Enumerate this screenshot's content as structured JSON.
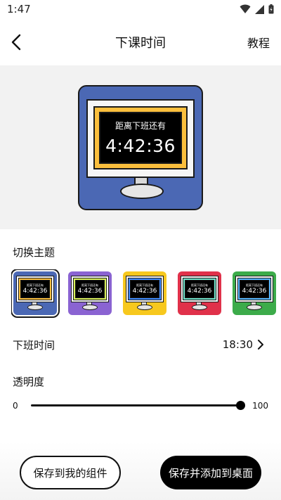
{
  "status_bar": {
    "time": "1:47",
    "icons": [
      "wifi-icon",
      "signal-icon",
      "battery-icon"
    ]
  },
  "header": {
    "title": "下课时间",
    "tutorial": "教程",
    "back_icon": "chevron-left-icon"
  },
  "preview": {
    "label": "距离下班还有",
    "countdown": "4:42:36",
    "background": "#4b68b4",
    "screen_color": "#fbbf3d"
  },
  "theme_section": {
    "label": "切换主题",
    "themes": [
      {
        "label": "距离下班还有",
        "time": "4:42:36",
        "background": "#4b68b4",
        "screen_color": "#fbbf3d",
        "selected": true
      },
      {
        "label": "距离下班还有",
        "time": "4:42:36",
        "background": "#8a63d2",
        "screen_color": "#d9f05a",
        "selected": false
      },
      {
        "label": "距离下班还有",
        "time": "4:42:36",
        "background": "#f7c81e",
        "screen_color": "#3f8cff",
        "selected": false
      },
      {
        "label": "距离下班还有",
        "time": "4:42:36",
        "background": "#e0314a",
        "screen_color": "#6fe0c8",
        "selected": false
      },
      {
        "label": "距离下班还有",
        "time": "4:42:36",
        "background": "#3cab4a",
        "screen_color": "#57b8ff",
        "selected": false
      }
    ]
  },
  "off_work": {
    "label": "下班时间",
    "value": "18:30"
  },
  "opacity": {
    "label": "透明度",
    "min": "0",
    "max": "100",
    "value": 100
  },
  "buttons": {
    "save_widget": "保存到我的组件",
    "save_add_desktop": "保存并添加到桌面"
  }
}
